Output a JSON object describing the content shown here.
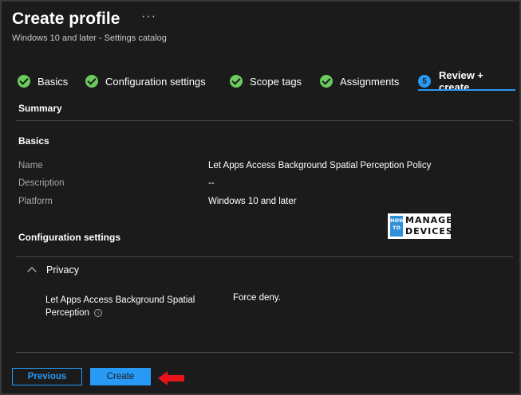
{
  "header": {
    "title": "Create profile",
    "more_label": "···",
    "subtitle": "Windows 10 and later - Settings catalog"
  },
  "steps": [
    {
      "label": "Basics",
      "state": "complete"
    },
    {
      "label": "Configuration settings",
      "state": "complete"
    },
    {
      "label": "Scope tags",
      "state": "complete"
    },
    {
      "label": "Assignments",
      "state": "complete"
    },
    {
      "label": "Review + create",
      "number": "5",
      "state": "active"
    }
  ],
  "summary": {
    "heading": "Summary",
    "basics_heading": "Basics",
    "fields": [
      {
        "key": "Name",
        "value": "Let Apps Access Background Spatial Perception Policy"
      },
      {
        "key": "Description",
        "value": "--"
      },
      {
        "key": "Platform",
        "value": "Windows 10 and later"
      }
    ],
    "config_heading": "Configuration settings"
  },
  "logo": {
    "how": "HOW TO",
    "line1": "MANAGE",
    "line2": "DEVICES"
  },
  "privacy": {
    "label": "Privacy",
    "setting_name": "Let Apps Access Background Spatial Perception",
    "info_symbol": "i",
    "setting_value": "Force deny."
  },
  "footer": {
    "previous_label": "Previous",
    "create_label": "Create"
  },
  "colors": {
    "accent": "#2899f5",
    "check": "#6ccb5f",
    "annotation_arrow": "#e8141b",
    "background": "#1b1b1b"
  }
}
